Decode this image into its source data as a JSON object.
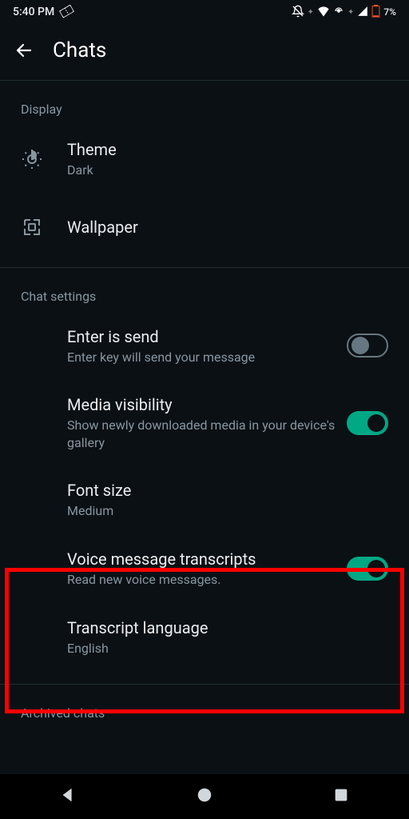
{
  "status": {
    "time": "5:40 PM",
    "battery": "7%"
  },
  "header": {
    "title": "Chats"
  },
  "sections": {
    "display": {
      "title": "Display",
      "theme": {
        "title": "Theme",
        "subtitle": "Dark"
      },
      "wallpaper": {
        "title": "Wallpaper"
      }
    },
    "chat_settings": {
      "title": "Chat settings",
      "enter_is_send": {
        "title": "Enter is send",
        "subtitle": "Enter key will send your message"
      },
      "media_visibility": {
        "title": "Media visibility",
        "subtitle": "Show newly downloaded media in your device's gallery"
      },
      "font_size": {
        "title": "Font size",
        "subtitle": "Medium"
      },
      "voice_transcripts": {
        "title": "Voice message transcripts",
        "subtitle": "Read new voice messages."
      },
      "transcript_language": {
        "title": "Transcript language",
        "subtitle": "English"
      }
    },
    "archived": {
      "title": "Archived chats"
    }
  }
}
